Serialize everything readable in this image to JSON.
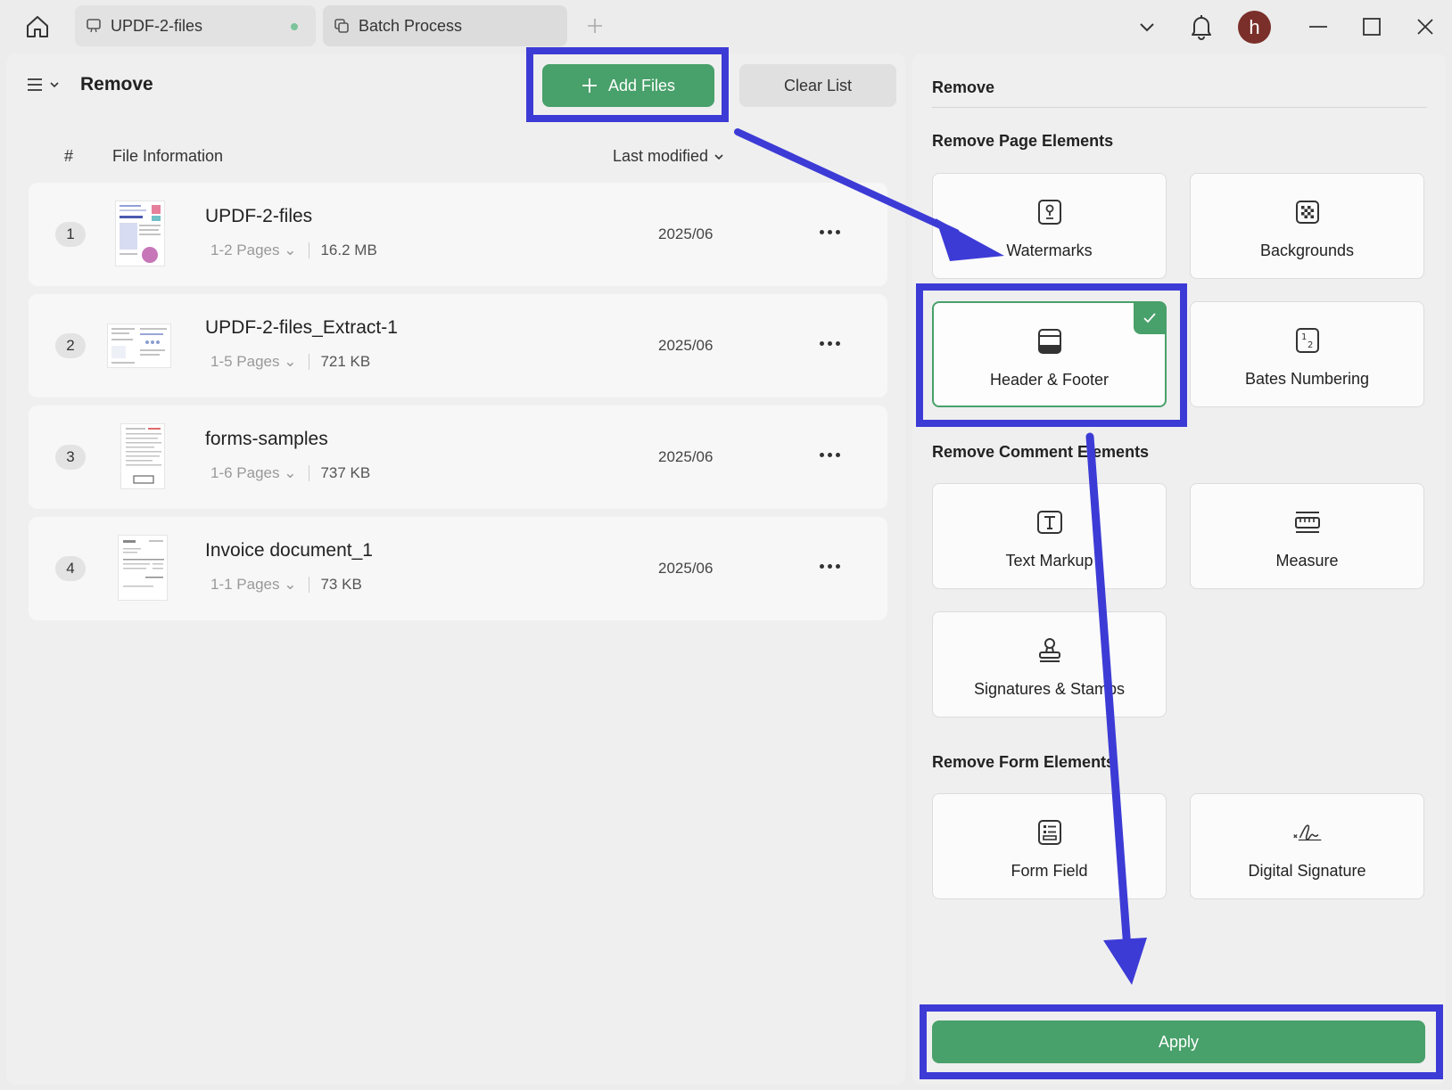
{
  "titlebar": {
    "tabs": [
      {
        "label": "UPDF-2-files",
        "icon": "monitor-icon",
        "active_dot": true
      },
      {
        "label": "Batch Process",
        "icon": "batch-copy-icon"
      }
    ],
    "avatar_letter": "h"
  },
  "left": {
    "title": "Remove",
    "add_files_label": "Add Files",
    "clear_list_label": "Clear List",
    "columns": {
      "number": "#",
      "info": "File Information",
      "modified": "Last modified"
    },
    "files": [
      {
        "num": "1",
        "name": "UPDF-2-files",
        "pages": "1-2 Pages",
        "size": "16.2 MB",
        "date": "2025/06"
      },
      {
        "num": "2",
        "name": "UPDF-2-files_Extract-1",
        "pages": "1-5 Pages",
        "size": "721 KB",
        "date": "2025/06"
      },
      {
        "num": "3",
        "name": "forms-samples",
        "pages": "1-6 Pages",
        "size": "737 KB",
        "date": "2025/06"
      },
      {
        "num": "4",
        "name": "Invoice document_1",
        "pages": "1-1 Pages",
        "size": "73 KB",
        "date": "2025/06"
      }
    ]
  },
  "right": {
    "title": "Remove",
    "sections": {
      "page": "Remove Page Elements",
      "comment": "Remove Comment Elements",
      "form": "Remove Form Elements"
    },
    "options": {
      "watermarks": "Watermarks",
      "backgrounds": "Backgrounds",
      "header_footer": "Header & Footer",
      "bates": "Bates Numbering",
      "text_markup": "Text Markup",
      "measure": "Measure",
      "signatures": "Signatures & Stamps",
      "form_field": "Form Field",
      "digital_signature": "Digital Signature"
    },
    "selected_option": "Header & Footer",
    "apply_label": "Apply"
  },
  "colors": {
    "accent_green": "#48a06a",
    "annotation_blue": "#3d3bd6",
    "avatar": "#7a2f2a"
  }
}
